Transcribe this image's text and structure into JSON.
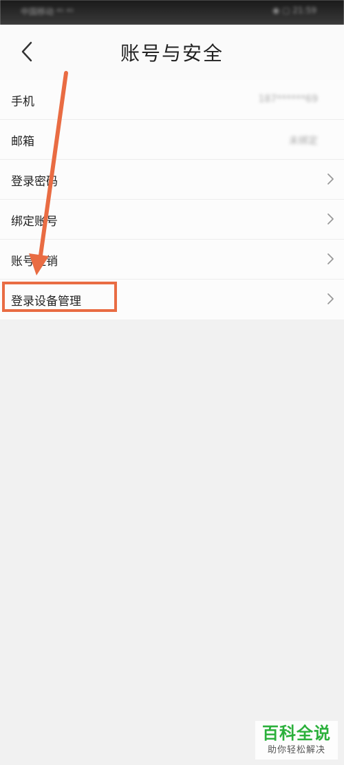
{
  "status_bar": {
    "left_text": "中国移动 ⁴ᴳ ⁴ᴳ",
    "right_text": "◉ ▢ 21:59"
  },
  "header": {
    "title": "账号与安全"
  },
  "settings": {
    "items": [
      {
        "label": "手机",
        "value": "187******69"
      },
      {
        "label": "邮箱",
        "value": "未绑定"
      },
      {
        "label": "登录密码"
      },
      {
        "label": "绑定账号"
      },
      {
        "label": "账号注销"
      },
      {
        "label": "登录设备管理"
      }
    ]
  },
  "annotation": {
    "color": "#e96c43"
  },
  "watermark": {
    "main": "百科全说",
    "sub": "助你轻松解决",
    "color": "#2bb03b"
  },
  "icons": {
    "back": "back-arrow-icon",
    "chevron": "chevron-right-icon"
  }
}
